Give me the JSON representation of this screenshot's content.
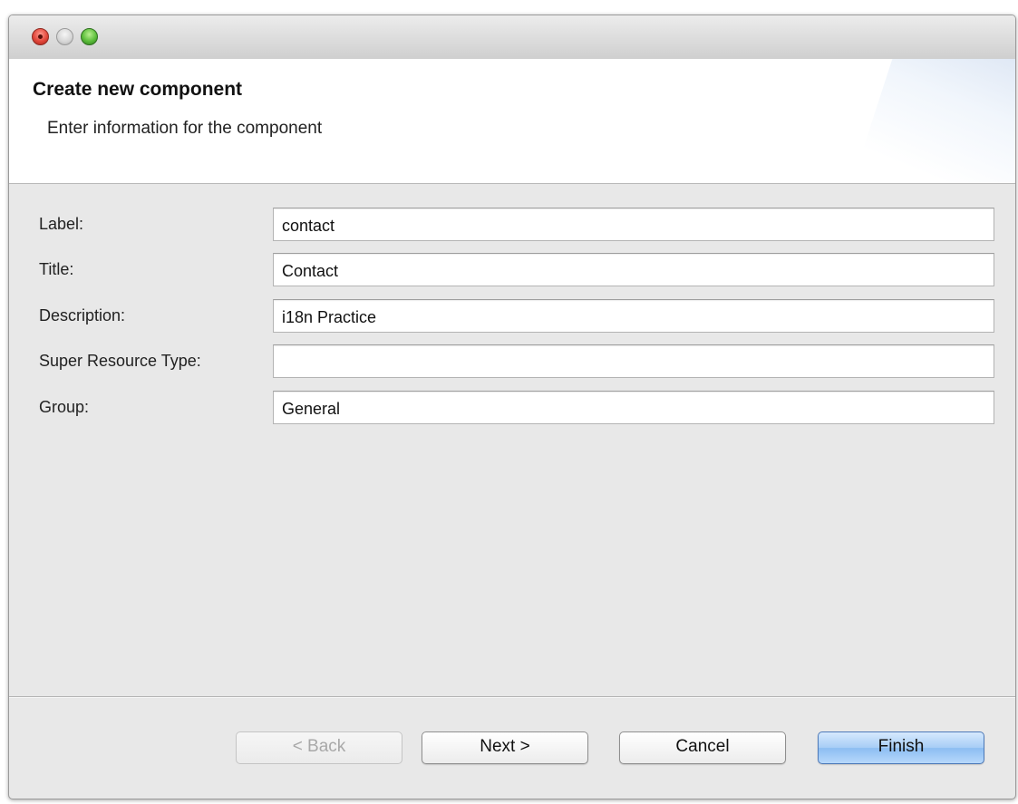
{
  "header": {
    "title": "Create new component",
    "subtitle": "Enter information for the component"
  },
  "form": {
    "fields": [
      {
        "label": "Label:",
        "value": "contact",
        "placeholder": ""
      },
      {
        "label": "Title:",
        "value": "Contact",
        "placeholder": ""
      },
      {
        "label": "Description:",
        "value": "i18n Practice",
        "placeholder": ""
      },
      {
        "label": "Super Resource Type:",
        "value": "",
        "placeholder": ""
      },
      {
        "label": "Group:",
        "value": "General",
        "placeholder": ""
      }
    ]
  },
  "buttons": {
    "back": "< Back",
    "next": "Next >",
    "cancel": "Cancel",
    "finish": "Finish"
  },
  "colors": {
    "window_bg": "#e8e8e8",
    "header_bg": "#ffffff",
    "finish_accent": "#a7cdf6",
    "close_button": "#e2473b",
    "zoom_button": "#5bbd3a"
  }
}
